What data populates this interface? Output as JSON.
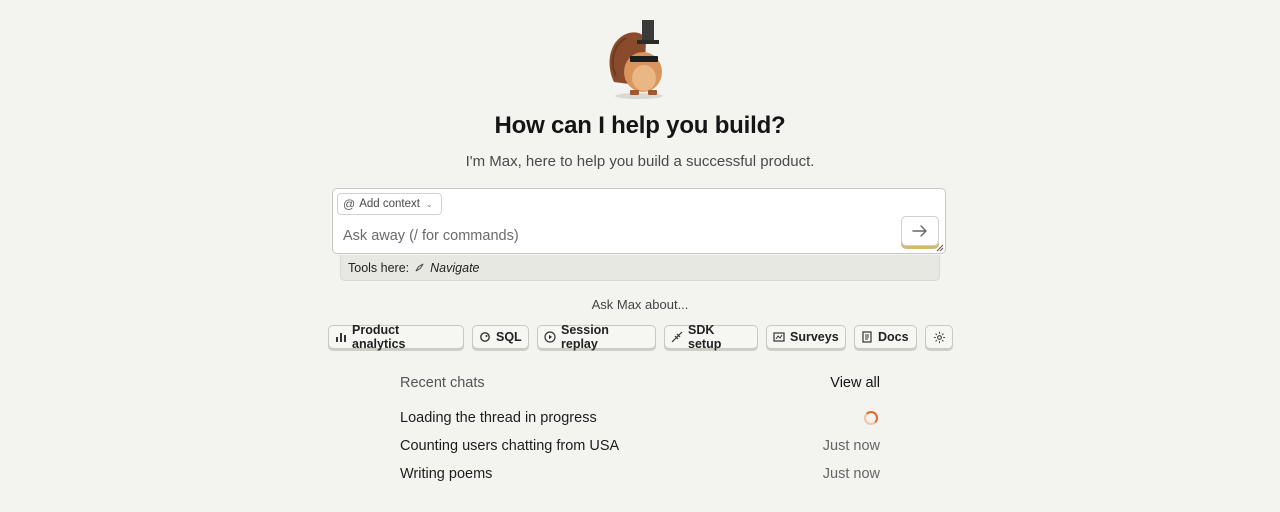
{
  "hero": {
    "title": "How can I help you build?",
    "subtitle": "I'm Max, here to help you build a successful product."
  },
  "input": {
    "add_context_label": "Add context",
    "placeholder": "Ask away (/ for commands)"
  },
  "tools": {
    "prefix": "Tools here:",
    "navigate": "Navigate"
  },
  "suggestions": {
    "heading": "Ask Max about...",
    "chips": [
      {
        "label": "Product analytics",
        "icon": "bar-chart-icon"
      },
      {
        "label": "SQL",
        "icon": "hedgehog-icon"
      },
      {
        "label": "Session replay",
        "icon": "play-icon"
      },
      {
        "label": "SDK setup",
        "icon": "plug-icon"
      },
      {
        "label": "Surveys",
        "icon": "survey-icon"
      },
      {
        "label": "Docs",
        "icon": "docs-icon"
      }
    ],
    "settings_icon": "gear-icon"
  },
  "recent": {
    "heading": "Recent chats",
    "view_all": "View all",
    "chats": [
      {
        "title": "Loading the thread in progress",
        "status": "loading"
      },
      {
        "title": "Counting users chatting from USA",
        "time": "Just now"
      },
      {
        "title": "Writing poems",
        "time": "Just now"
      }
    ]
  },
  "colors": {
    "background": "#f3f3ef",
    "accent": "#e8652d",
    "send_shadow": "#d9b86c"
  }
}
